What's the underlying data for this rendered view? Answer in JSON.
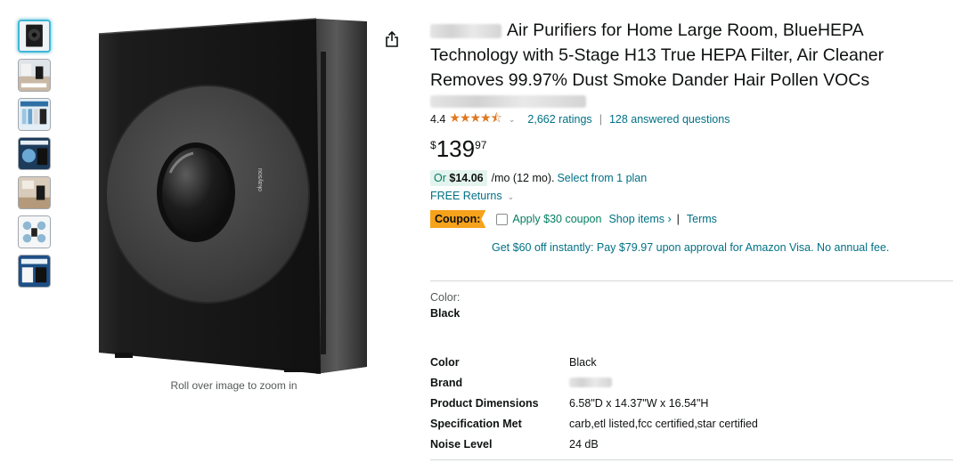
{
  "product": {
    "title_text": "Air Purifiers for Home Large Room, BlueHEPA Technology with 5-Stage H13 True HEPA Filter, Air Cleaner Removes 99.97% Dust Smoke Dander Hair Pollen VOCs",
    "rating": "4.4",
    "stars": "★★★★⯪",
    "ratings_count": "2,662 ratings",
    "answered_questions": "128 answered questions",
    "price": {
      "symbol": "$",
      "whole": "139",
      "fraction": "97"
    },
    "monthly": {
      "prefix": "Or",
      "amount": "$14.06",
      "suffix": "/mo (12 mo).",
      "plan_link": "Select from 1 plan"
    },
    "free_returns": "FREE Returns",
    "coupon": {
      "badge": "Coupon:",
      "apply": "Apply $30 coupon",
      "shop": "Shop items ›",
      "separator": "|",
      "terms": "Terms"
    },
    "visa_offer": "Get $60 off instantly: Pay $79.97 upon approval for Amazon Visa. No annual fee.",
    "color_label": "Color:",
    "color_value": "Black"
  },
  "gallery": {
    "zoom_hint": "Roll over image to zoom in",
    "logo_text": "okaysou",
    "thumbnails": 7
  },
  "specs": [
    {
      "key": "Color",
      "value": "Black"
    },
    {
      "key": "Brand",
      "value": ""
    },
    {
      "key": "Product Dimensions",
      "value": "6.58\"D x 14.37\"W x 16.54\"H"
    },
    {
      "key": "Specification Met",
      "value": "carb,etl listed,fcc certified,star certified"
    },
    {
      "key": "Noise Level",
      "value": "24 dB"
    }
  ],
  "colors": {
    "link": "#007185",
    "star": "#de7921",
    "coupon": "#f7a21b",
    "deal_green": "#067d62"
  },
  "icons": {
    "share": "share-icon",
    "caret": "chevron-down-icon"
  }
}
